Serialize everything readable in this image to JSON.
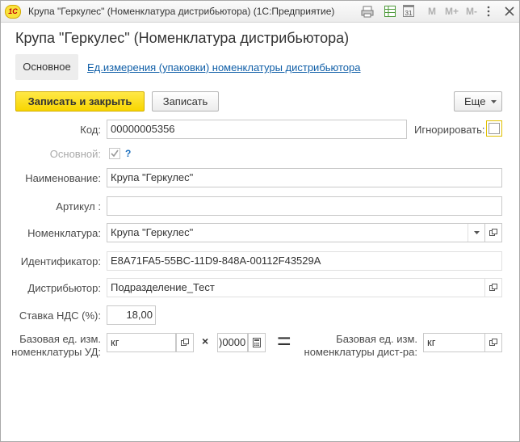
{
  "window": {
    "title": "Крупа \"Геркулес\" (Номенклатура дистрибьютора)  (1С:Предприятие)",
    "logo": "1С",
    "m": "M",
    "mplus": "M+",
    "mminus": "M-",
    "calendar_day": "31"
  },
  "form": {
    "header": "Крупа \"Геркулес\" (Номенклатура дистрибьютора)",
    "tabs": {
      "main": "Основное",
      "units": "Ед.измерения (упаковки)  номенклатуры дистрибьютора"
    },
    "buttons": {
      "save_close": "Записать и закрыть",
      "save": "Записать",
      "more": "Еще"
    },
    "fields": {
      "code_label": "Код:",
      "code_value": "00000005356",
      "ignore_label": "Игнорировать:",
      "ignore_checked": false,
      "main_label": "Основной:",
      "main_checked": true,
      "help": "?",
      "name_label": "Наименование:",
      "name_value": "Крупа \"Геркулес\"",
      "article_label": "Артикул :",
      "article_value": "",
      "nomenclature_label": "Номенклатура:",
      "nomenclature_value": "Крупа \"Геркулес\"",
      "id_label": "Идентификатор:",
      "id_value": "E8A71FA5-55BC-11D9-848A-00112F43529A",
      "distributor_label": "Дистрибьютор:",
      "distributor_value": "Подразделение_Тест",
      "vat_label": "Ставка НДС (%):",
      "vat_value": "18,00",
      "base_unit_ud_label_1": "Базовая ед. изм.",
      "base_unit_ud_label_2": "номенклатуры УД:",
      "base_unit_ud_value": "кг",
      "multiply": "×",
      "coef_value": ")0000",
      "equals": "=",
      "base_unit_dist_label_1": "Базовая ед. изм.",
      "base_unit_dist_label_2": "номенклатуры дист-ра:",
      "base_unit_dist_value": "кг"
    }
  }
}
